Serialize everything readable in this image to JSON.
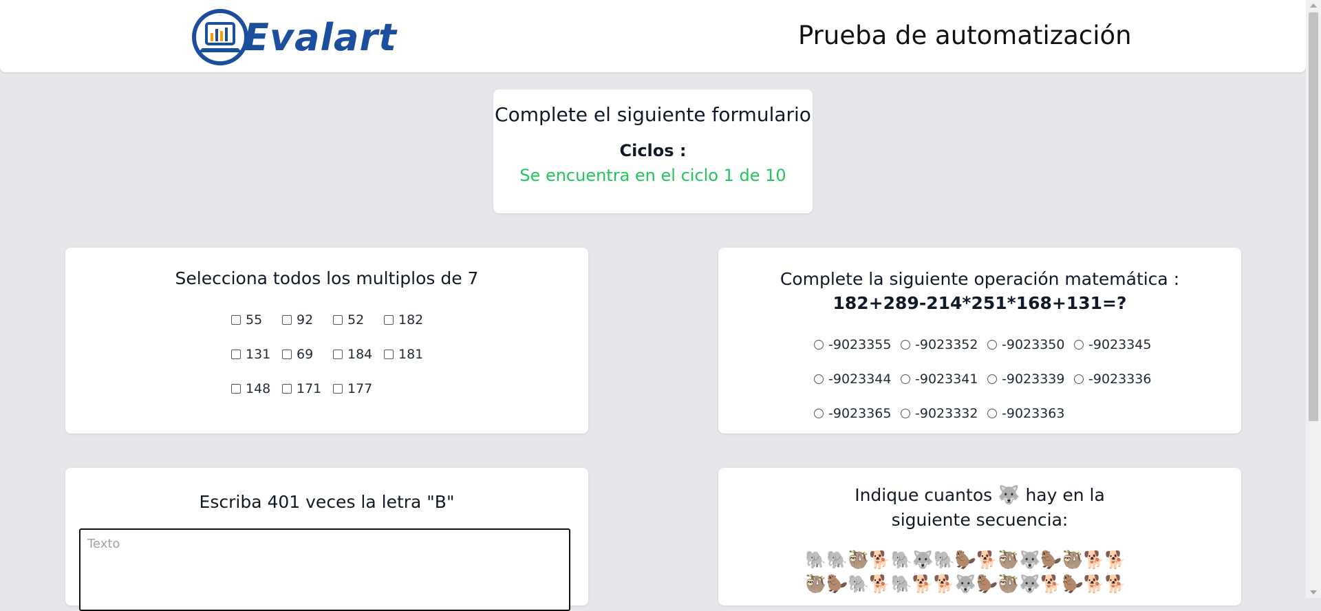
{
  "header": {
    "logo_text": "Evalart",
    "title": "Prueba de automatización"
  },
  "intro": {
    "title": "Complete el siguiente formulario",
    "cycles_label": "Ciclos :",
    "cycles_status": "Se encuentra en el ciclo 1 de 10"
  },
  "multiples": {
    "title": "Selecciona todos los multiplos de 7",
    "options": [
      "55",
      "92",
      "52",
      "182",
      "131",
      "69",
      "184",
      "181",
      "148",
      "171",
      "177"
    ]
  },
  "math": {
    "title": "Complete la siguiente operación matemática :",
    "expression": "182+289-214*251*168+131=?",
    "options": [
      "-9023355",
      "-9023352",
      "-9023350",
      "-9023345",
      "-9023344",
      "-9023341",
      "-9023339",
      "-9023336",
      "-9023365",
      "-9023332",
      "-9023363"
    ]
  },
  "letters": {
    "title": "Escriba 401 veces la letra \"B\"",
    "placeholder": "Texto"
  },
  "emoji": {
    "title_before": "Indique cuantos",
    "title_icon": "🐺",
    "title_after": "hay en la siguiente secuencia:",
    "row1": "🐘🐘🦥🐕🐘🐺🐘🦫🐕🦥🐺🦫🦥🐕🐕",
    "row2": "🦥🦫🐘🐕🐘🐕🐕🐺🦫🦥🐺🐕🦫🐕🐕"
  }
}
